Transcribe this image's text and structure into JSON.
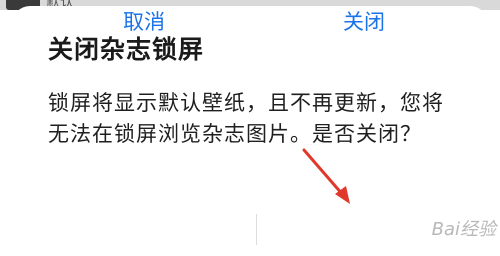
{
  "dialog": {
    "title": "关闭杂志锁屏",
    "message": "锁屏将显示默认壁纸，且不再更新，您将无法在锁屏浏览杂志图片。是否关闭？",
    "buttons": {
      "cancel": "取消",
      "close": "关闭"
    }
  },
  "background": {
    "partial_text": "默认"
  },
  "colors": {
    "accent": "#1a73e8",
    "annotation_arrow": "#e0392b"
  },
  "watermark": {
    "text": "Bai经验"
  }
}
